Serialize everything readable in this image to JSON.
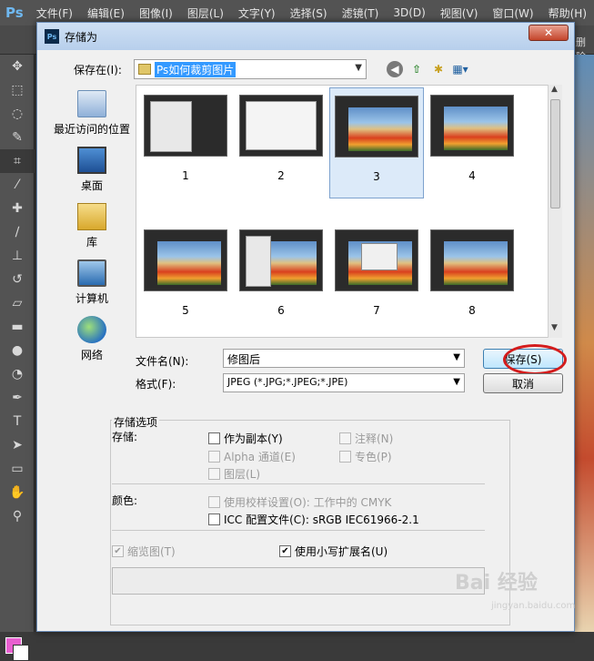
{
  "ps": {
    "logo": "Ps",
    "menu": [
      "文件(F)",
      "编辑(E)",
      "图像(I)",
      "图层(L)",
      "文字(Y)",
      "选择(S)",
      "滤镜(T)",
      "3D(D)",
      "视图(V)",
      "窗口(W)",
      "帮助(H)"
    ],
    "right_label": "删除",
    "fg_color": "#e85fd0",
    "bg_color": "#ffffff"
  },
  "dialog": {
    "title": "存储为",
    "close": "✕",
    "save_in_label": "保存在(I):",
    "save_in_value": "Ps如何裁剪图片",
    "places": [
      "最近访问的位置",
      "桌面",
      "库",
      "计算机",
      "网络"
    ],
    "files": [
      "1",
      "2",
      "3",
      "4",
      "5",
      "6",
      "7",
      "8"
    ],
    "selected_file": "3",
    "filename_label": "文件名(N):",
    "filename_value": "修图后",
    "format_label": "格式(F):",
    "format_value": "JPEG (*.JPG;*.JPEG;*.JPE)",
    "save_button": "保存(S)",
    "cancel_button": "取消"
  },
  "options": {
    "group_title": "存储选项",
    "store_label": "存储:",
    "as_copy": "作为副本(Y)",
    "notes": "注释(N)",
    "alpha": "Alpha 通道(E)",
    "spot": "专色(P)",
    "layers": "图层(L)",
    "color_label": "颜色:",
    "use_proof": "使用校样设置(O): 工作中的 CMYK",
    "icc": "ICC 配置文件(C): sRGB IEC61966-2.1",
    "thumbnail": "缩览图(T)",
    "lowercase_ext": "使用小写扩展名(U)",
    "thumbnail_checked": true,
    "lowercase_checked": true
  },
  "watermark": {
    "text": "Bai 经验",
    "sub": "jingyan.baidu.com"
  }
}
